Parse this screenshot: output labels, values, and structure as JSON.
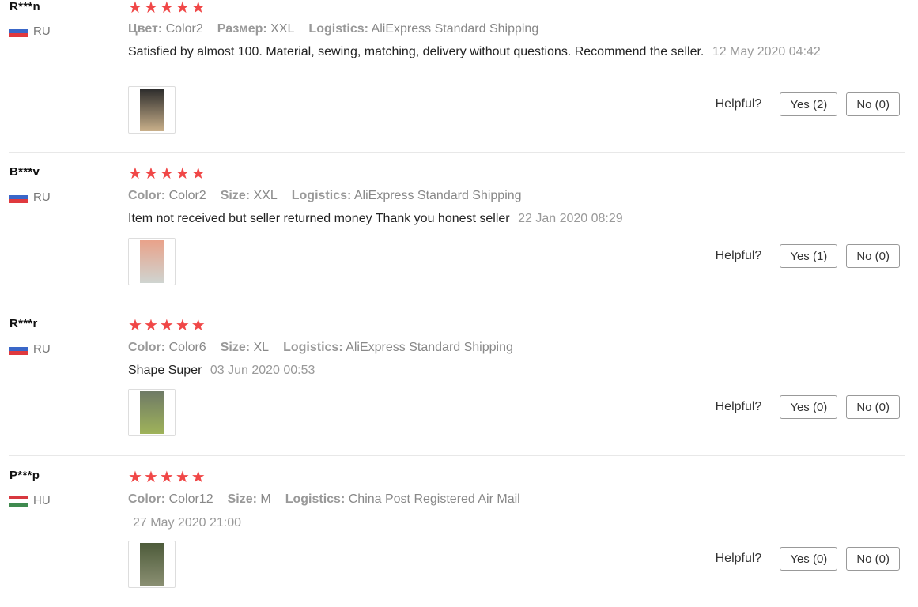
{
  "colors": {
    "star": "#f04747",
    "muted": "#999999"
  },
  "helpful_label": "Helpful?",
  "reviews": [
    {
      "user": "R***n",
      "country": "RU",
      "flag": "russia-flag",
      "stars": 5,
      "attrs": [
        {
          "k": "Цвет:",
          "v": "Color2"
        },
        {
          "k": "Размер:",
          "v": "XXL"
        },
        {
          "k": "Logistics:",
          "v": "AliExpress Standard Shipping"
        }
      ],
      "text": "Satisfied by almost 100. Material, sewing, matching, delivery without questions. Recommend the seller.",
      "date": "12 May 2020 04:42",
      "yes": "Yes (2)",
      "no": "No (0)"
    },
    {
      "user": "B***v",
      "country": "RU",
      "flag": "russia-flag",
      "stars": 5,
      "attrs": [
        {
          "k": "Color:",
          "v": "Color2"
        },
        {
          "k": "Size:",
          "v": "XXL"
        },
        {
          "k": "Logistics:",
          "v": "AliExpress Standard Shipping"
        }
      ],
      "text": "Item not received but seller returned money Thank you honest seller",
      "date": "22 Jan 2020 08:29",
      "yes": "Yes (1)",
      "no": "No (0)"
    },
    {
      "user": "R***r",
      "country": "RU",
      "flag": "russia-flag",
      "stars": 5,
      "attrs": [
        {
          "k": "Color:",
          "v": "Color6"
        },
        {
          "k": "Size:",
          "v": "XL"
        },
        {
          "k": "Logistics:",
          "v": "AliExpress Standard Shipping"
        }
      ],
      "text": "Shape Super",
      "date": "03 Jun 2020 00:53",
      "yes": "Yes (0)",
      "no": "No (0)"
    },
    {
      "user": "P***p",
      "country": "HU",
      "flag": "hungary-flag",
      "stars": 5,
      "attrs": [
        {
          "k": "Color:",
          "v": "Color12"
        },
        {
          "k": "Size:",
          "v": "M"
        },
        {
          "k": "Logistics:",
          "v": "China Post Registered Air Mail"
        }
      ],
      "text": "",
      "date": "27 May 2020 21:00",
      "yes": "Yes (0)",
      "no": "No (0)"
    }
  ]
}
